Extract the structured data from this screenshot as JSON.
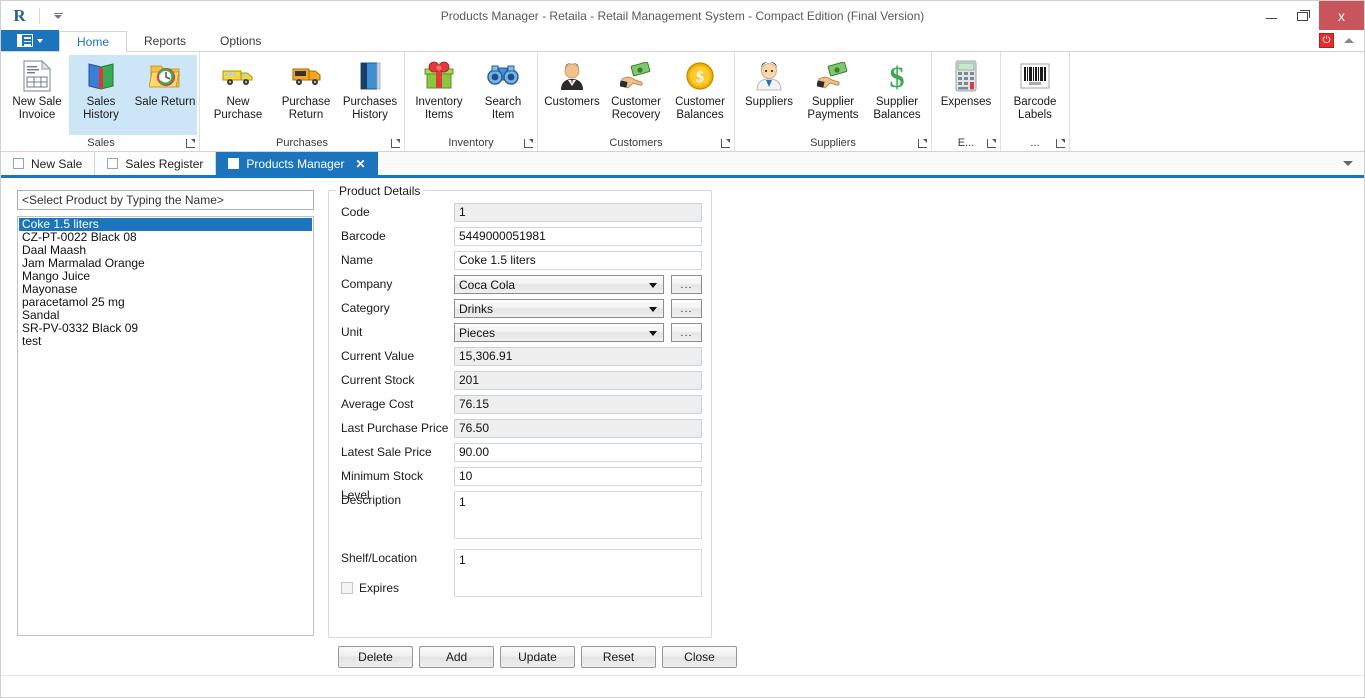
{
  "window": {
    "title": "Products Manager - Retaila - Retail Management System - Compact Edition (Final Version)",
    "logo": "R",
    "minimize_label": "Minimize",
    "maximize_label": "Restore",
    "close_label": "x",
    "qat_dropdown_label": "Customize Quick Access Toolbar"
  },
  "ribbon": {
    "app_menu_label": "File",
    "tabs": [
      {
        "label": "Home",
        "active": true
      },
      {
        "label": "Reports",
        "active": false
      },
      {
        "label": "Options",
        "active": false
      }
    ],
    "power_icon": "power-icon",
    "collapse_icon": "chevron-up-icon",
    "groups": [
      {
        "name": "Sales",
        "label": "Sales",
        "has_launcher": true,
        "items": [
          {
            "label": "New Sale\nInvoice",
            "line1": "New Sale",
            "line2": "Invoice",
            "icon": "invoice-icon",
            "selected": false
          },
          {
            "label": "Sales History",
            "line1": "Sales",
            "line2": "History",
            "icon": "book-icon",
            "selected": true
          },
          {
            "label": "Sale Return",
            "line1": "Sale Return",
            "line2": "",
            "icon": "folder-clock-icon",
            "selected": true
          }
        ]
      },
      {
        "name": "Purchases",
        "label": "Purchases",
        "has_launcher": true,
        "items": [
          {
            "label": "New Purchase",
            "line1": "New Purchase",
            "line2": "",
            "icon": "truck-icon",
            "selected": false
          },
          {
            "label": "Purchase Return",
            "line1": "Purchase",
            "line2": "Return",
            "icon": "truck-return-icon",
            "selected": false
          },
          {
            "label": "Purchases History",
            "line1": "Purchases",
            "line2": "History",
            "icon": "blue-book-icon",
            "selected": false
          }
        ]
      },
      {
        "name": "Inventory",
        "label": "Inventory",
        "has_launcher": true,
        "items": [
          {
            "label": "Inventory Items",
            "line1": "Inventory",
            "line2": "Items",
            "icon": "gift-box-icon",
            "selected": false
          },
          {
            "label": "Search Item",
            "line1": "Search",
            "line2": "Item",
            "icon": "binoculars-icon",
            "selected": false
          }
        ]
      },
      {
        "name": "Customers",
        "label": "Customers",
        "has_launcher": true,
        "items": [
          {
            "label": "Customers",
            "line1": "Customers",
            "line2": "",
            "icon": "person-suit-icon",
            "selected": false
          },
          {
            "label": "Customer Recovery",
            "line1": "Customer",
            "line2": "Recovery",
            "icon": "hand-money-icon",
            "selected": false
          },
          {
            "label": "Customer Balances",
            "line1": "Customer",
            "line2": "Balances",
            "icon": "gold-coin-icon",
            "selected": false
          }
        ]
      },
      {
        "name": "Suppliers",
        "label": "Suppliers",
        "has_launcher": true,
        "items": [
          {
            "label": "Suppliers",
            "line1": "Suppliers",
            "line2": "",
            "icon": "person-tie-icon",
            "selected": false
          },
          {
            "label": "Supplier Payments",
            "line1": "Supplier",
            "line2": "Payments",
            "icon": "hand-money-icon",
            "selected": false
          },
          {
            "label": "Supplier Balances",
            "line1": "Supplier",
            "line2": "Balances",
            "icon": "dollar-sign-icon",
            "selected": false
          }
        ]
      },
      {
        "name": "Expenses",
        "label": "E...",
        "has_launcher": true,
        "items": [
          {
            "label": "Expenses",
            "line1": "Expenses",
            "line2": "",
            "icon": "calculator-icon",
            "selected": false
          }
        ]
      },
      {
        "name": "Barcode",
        "label": "...",
        "has_launcher": true,
        "items": [
          {
            "label": "Barcode Labels",
            "line1": "Barcode",
            "line2": "Labels",
            "icon": "barcode-icon",
            "selected": false
          }
        ]
      }
    ]
  },
  "doctabs": {
    "tabs": [
      {
        "label": "New Sale",
        "active": false,
        "closable": false
      },
      {
        "label": "Sales Register",
        "active": false,
        "closable": false
      },
      {
        "label": "Products Manager",
        "active": true,
        "closable": true,
        "close_glyph": "✕"
      }
    ],
    "overflow_icon": "chevron-down-icon"
  },
  "left_panel": {
    "search_placeholder": "<Select Product by Typing the Name>",
    "search_value": "",
    "products": [
      {
        "name": "Coke  1.5 liters",
        "selected": true
      },
      {
        "name": "CZ-PT-0022 Black 08",
        "selected": false
      },
      {
        "name": "Daal Maash",
        "selected": false
      },
      {
        "name": "Jam Marmalad Orange",
        "selected": false
      },
      {
        "name": "Mango Juice",
        "selected": false
      },
      {
        "name": "Mayonase",
        "selected": false
      },
      {
        "name": "paracetamol 25 mg",
        "selected": false
      },
      {
        "name": "Sandal",
        "selected": false
      },
      {
        "name": "SR-PV-0332 Black 09",
        "selected": false
      },
      {
        "name": "test",
        "selected": false
      }
    ]
  },
  "product_details": {
    "group_title": "Product Details",
    "fields": {
      "code": {
        "label": "Code",
        "value": "1",
        "readonly": true
      },
      "barcode": {
        "label": "Barcode",
        "value": "5449000051981",
        "readonly": false
      },
      "name": {
        "label": "Name",
        "value": "Coke  1.5 liters",
        "readonly": false
      },
      "company": {
        "label": "Company",
        "value": "Coca Cola",
        "browse_label": "..."
      },
      "category": {
        "label": "Category",
        "value": "Drinks",
        "browse_label": "..."
      },
      "unit": {
        "label": "Unit",
        "value": "Pieces",
        "browse_label": "..."
      },
      "current_value": {
        "label": "Current Value",
        "value": "15,306.91",
        "readonly": true
      },
      "current_stock": {
        "label": "Current Stock",
        "value": "201",
        "readonly": true
      },
      "average_cost": {
        "label": "Average Cost",
        "value": "76.15",
        "readonly": true
      },
      "last_purchase_price": {
        "label": "Last Purchase Price",
        "value": "76.50",
        "readonly": true
      },
      "latest_sale_price": {
        "label": "Latest Sale Price",
        "value": "90.00",
        "readonly": false
      },
      "minimum_stock_level": {
        "label": "Minimum Stock Level",
        "value": "10",
        "readonly": false
      },
      "description": {
        "label": "Description",
        "value": "1"
      },
      "shelf_location": {
        "label": "Shelf/Location",
        "value": "1"
      },
      "expires": {
        "label": "Expires",
        "checked": false
      }
    }
  },
  "actions": {
    "buttons": [
      {
        "label": "Delete",
        "name": "delete-button"
      },
      {
        "label": "Add",
        "name": "add-button"
      },
      {
        "label": "Update",
        "name": "update-button"
      },
      {
        "label": "Reset",
        "name": "reset-button"
      },
      {
        "label": "Close",
        "name": "close-button"
      }
    ]
  },
  "colors": {
    "accent": "#1c75bc",
    "selection": "#1c75bc",
    "ribbon_selected": "#cde6f7",
    "close_button": "#c7555b",
    "power_red": "#e03030"
  }
}
